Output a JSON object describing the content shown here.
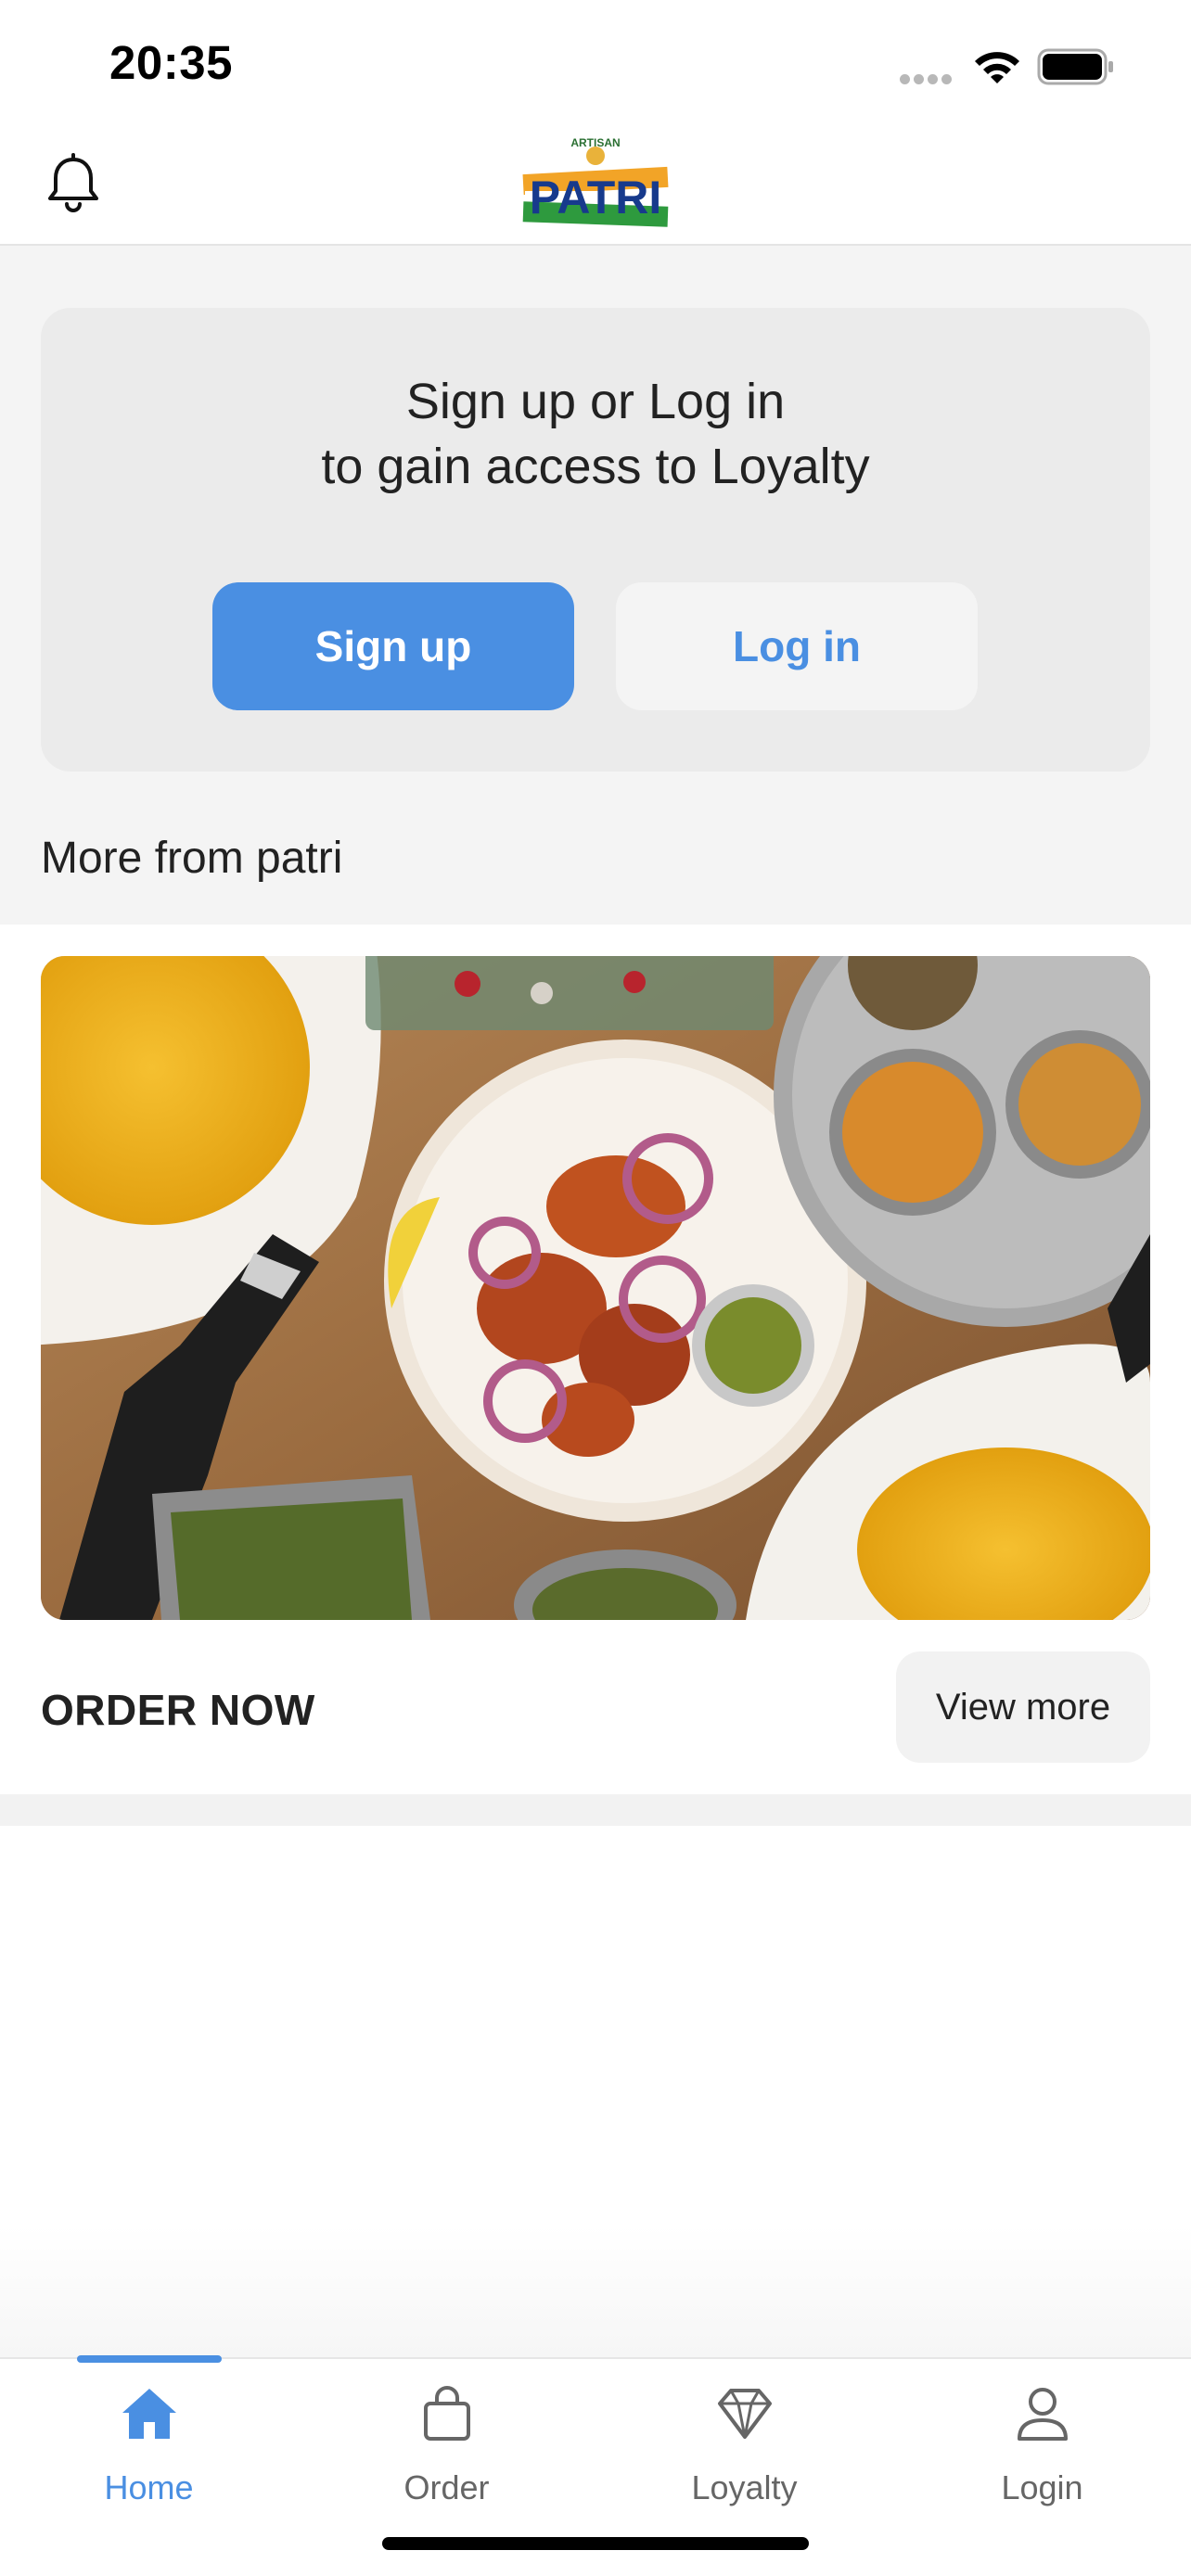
{
  "status_bar": {
    "time": "20:35"
  },
  "header": {
    "logo_alt": "Artisan Patri",
    "logo_small": "ARTISAN",
    "logo_main": "PATRI"
  },
  "loyalty": {
    "line1": "Sign up or Log in",
    "line2": "to gain access to Loyalty",
    "signup_label": "Sign up",
    "login_label": "Log in"
  },
  "section": {
    "title": "More from patri"
  },
  "promo": {
    "caption": "ORDER NOW",
    "view_more_label": "View more"
  },
  "tabs": [
    {
      "label": "Home",
      "icon": "home-icon",
      "active": true
    },
    {
      "label": "Order",
      "icon": "bag-icon",
      "active": false
    },
    {
      "label": "Loyalty",
      "icon": "diamond-icon",
      "active": false
    },
    {
      "label": "Login",
      "icon": "user-icon",
      "active": false
    }
  ],
  "colors": {
    "accent": "#4a8fe2",
    "card": "#ebebeb",
    "page": "#f4f4f4"
  }
}
